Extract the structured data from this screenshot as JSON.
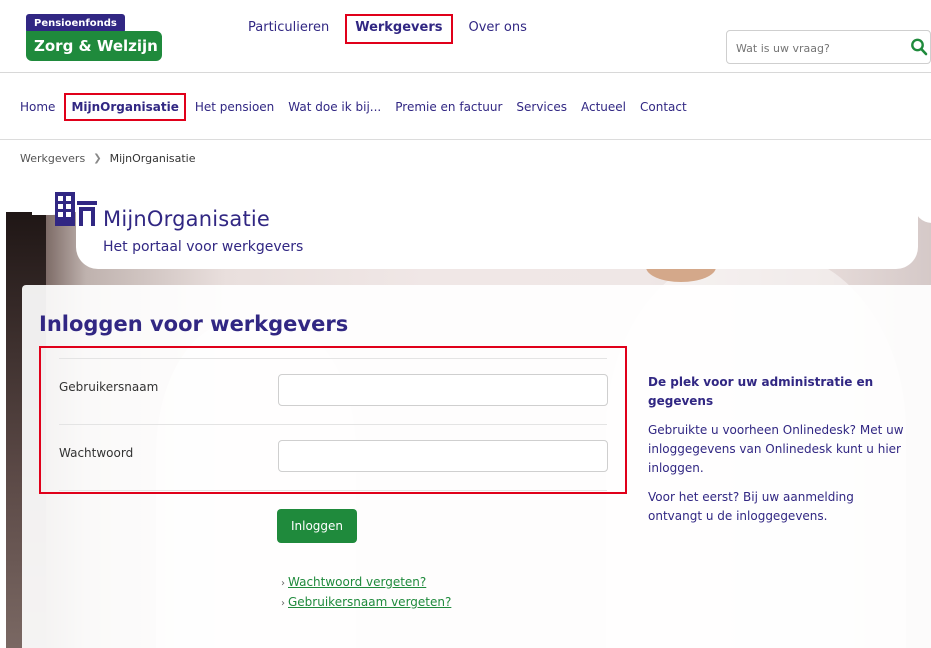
{
  "header": {
    "logo_small": "Pensioenfonds",
    "logo_big": "Zorg & Welzijn",
    "top_nav": [
      "Particulieren",
      "Werkgevers",
      "Over ons"
    ],
    "active_top": "Werkgevers",
    "search_placeholder": "Wat is uw vraag?"
  },
  "main_nav": {
    "items": [
      "Home",
      "MijnOrganisatie",
      "Het pensioen",
      "Wat doe ik bij...",
      "Premie en factuur",
      "Services",
      "Actueel",
      "Contact"
    ],
    "active": "MijnOrganisatie"
  },
  "breadcrumb": {
    "items": [
      "Werkgevers",
      "MijnOrganisatie"
    ]
  },
  "portal": {
    "title": "MijnOrganisatie",
    "subtitle": "Het portaal voor werkgevers"
  },
  "login": {
    "title": "Inloggen voor werkgevers",
    "username_label": "Gebruikersnaam",
    "username_value": "",
    "password_label": "Wachtwoord",
    "password_value": "",
    "submit_label": "Inloggen",
    "forgot_password": "Wachtwoord vergeten?",
    "forgot_username": "Gebruikersnaam vergeten?"
  },
  "info": {
    "title": "De plek voor uw administratie en gegevens",
    "paragraph1": "Gebruikte u voorheen Onlinedesk? Met uw inloggegevens van Onlinedesk kunt u hier inloggen.",
    "paragraph2": "Voor het eerst? Bij uw aanmelding ontvangt u de inloggegevens."
  },
  "colors": {
    "brand_purple": "#312783",
    "brand_green": "#1f8a3c",
    "highlight_red": "#e0001a"
  }
}
